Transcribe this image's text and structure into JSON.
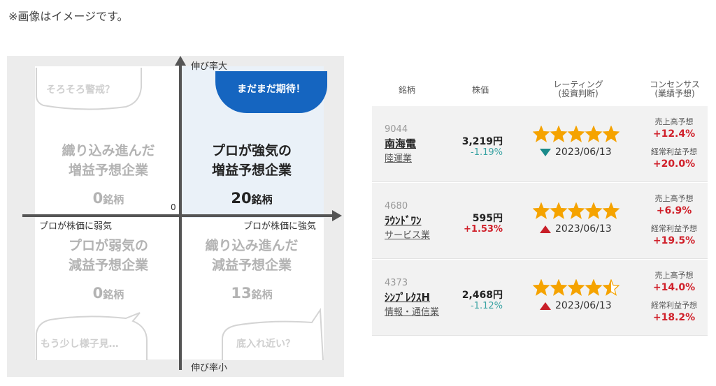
{
  "note": "※画像はイメージです。",
  "quadrant": {
    "axis_top": "伸び率大",
    "axis_bottom": "伸び率小",
    "axis_left": "プロが株価に弱気",
    "axis_right": "プロが株価に強気",
    "origin": "0",
    "top_left": {
      "line1": "織り込み進んだ",
      "line2": "増益予想企業",
      "count": "0",
      "unit": "銘柄",
      "bubble": "そろそろ警戒？"
    },
    "top_right": {
      "line1": "プロが強気の",
      "line2": "増益予想企業",
      "count": "20",
      "unit": "銘柄",
      "bubble": "まだまだ期待！"
    },
    "bottom_left": {
      "line1": "プロが弱気の",
      "line2": "減益予想企業",
      "count": "0",
      "unit": "銘柄",
      "bubble": "もう少し様子見…"
    },
    "bottom_right": {
      "line1": "織り込み進んだ",
      "line2": "減益予想企業",
      "count": "13",
      "unit": "銘柄",
      "bubble": "底入れ近い？"
    },
    "colors": {
      "bubble_blue": "#1565c0",
      "highlight": "#eaf1f8"
    }
  },
  "table": {
    "headers": {
      "name": "銘柄",
      "price": "株価",
      "rating_1": "レーティング",
      "rating_2": "(投資判断)",
      "consensus_1": "コンセンサス",
      "consensus_2": "(業績予想)"
    },
    "rows": [
      {
        "code": "9044",
        "name": "南海電",
        "sector": "陸運業",
        "price": "3,219円",
        "change": "-1.19%",
        "rating": 5,
        "rating_trend": "down",
        "rating_date": "2023/06/13",
        "sales_label": "売上高予想",
        "sales": "+12.4%",
        "profit_label": "経常利益予想",
        "profit": "+20.0%"
      },
      {
        "code": "4680",
        "name": "ﾗｳﾝﾄﾞﾜﾝ",
        "sector": "サービス業",
        "price": "595円",
        "change": "+1.53%",
        "rating": 5,
        "rating_trend": "up",
        "rating_date": "2023/06/13",
        "sales_label": "売上高予想",
        "sales": "+6.9%",
        "profit_label": "経常利益予想",
        "profit": "+19.5%"
      },
      {
        "code": "4373",
        "name": "ｼﾝﾌﾟﾚｸｽH",
        "sector": "情報・通信業",
        "price": "2,468円",
        "change": "-1.12%",
        "rating": 4.5,
        "rating_trend": "up",
        "rating_date": "2023/06/13",
        "sales_label": "売上高予想",
        "sales": "+14.0%",
        "profit_label": "経常利益予想",
        "profit": "+18.2%"
      }
    ],
    "colors": {
      "star": "#f5a300",
      "positive": "#d0202a",
      "negative": "#3aa3a3",
      "trend_down": "#1a8a8a",
      "trend_up": "#c81e28"
    }
  }
}
